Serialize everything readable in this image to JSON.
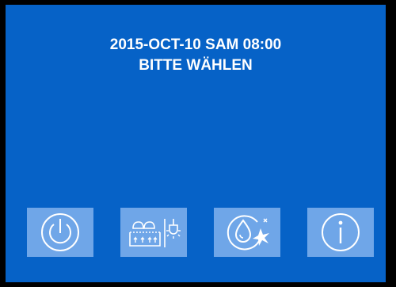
{
  "status": {
    "datetime": "2015-OCT-10 SAM 08:00",
    "prompt": "BITTE WÄHLEN"
  },
  "colors": {
    "screen_background": "#0662c7",
    "button_background": "#6fa6e8",
    "icon_color": "#ffffff",
    "text_color": "#ffffff"
  },
  "buttons": [
    {
      "icon": "power-icon"
    },
    {
      "icon": "hood-light-icon"
    },
    {
      "icon": "water-drop-clean-icon"
    },
    {
      "icon": "info-icon"
    }
  ]
}
